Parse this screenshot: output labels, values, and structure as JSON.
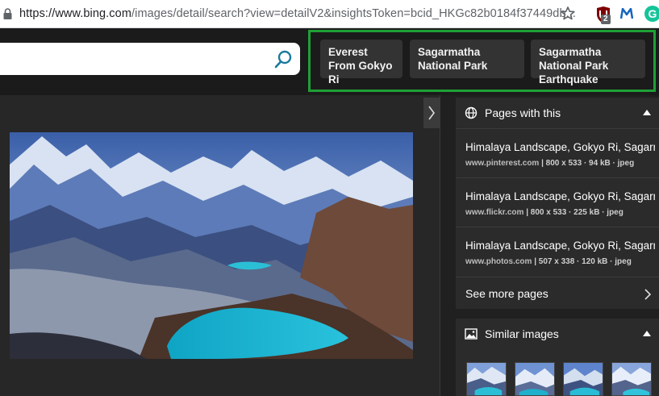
{
  "browser": {
    "url_host": "https://www.bing.com",
    "url_rest": "/images/detail/search?view=detailV2&insightsToken=bcid_HKGc82b0184f37449db...",
    "ublock_badge": "2",
    "grammarly_letter": "G"
  },
  "related_searches": [
    {
      "label": "Everest From Gokyo Ri"
    },
    {
      "label": "Sagarmatha National Park"
    },
    {
      "label": "Sagarmatha National Park Earthquake"
    }
  ],
  "pages_card": {
    "title": "Pages with this",
    "items": [
      {
        "title": "Himalaya Landscape, Gokyo Ri, Sagarmatha...",
        "domain": "www.pinterest.com",
        "info": " | 800 x 533 · 94 kB · jpeg"
      },
      {
        "title": "Himalaya Landscape, Gokyo Ri, Sagarmatha...",
        "domain": "www.flickr.com",
        "info": " | 800 x 533 · 225 kB · jpeg"
      },
      {
        "title": "Himalaya Landscape, Gokyo Ri, Sagarmatha...",
        "domain": "www.photos.com",
        "info": " | 507 x 338 · 120 kB · jpeg"
      }
    ],
    "see_more": "See more pages"
  },
  "similar_card": {
    "title": "Similar images"
  },
  "colors": {
    "highlight": "#1fa036",
    "accent": "#1a7a9c",
    "background": "#202020"
  }
}
